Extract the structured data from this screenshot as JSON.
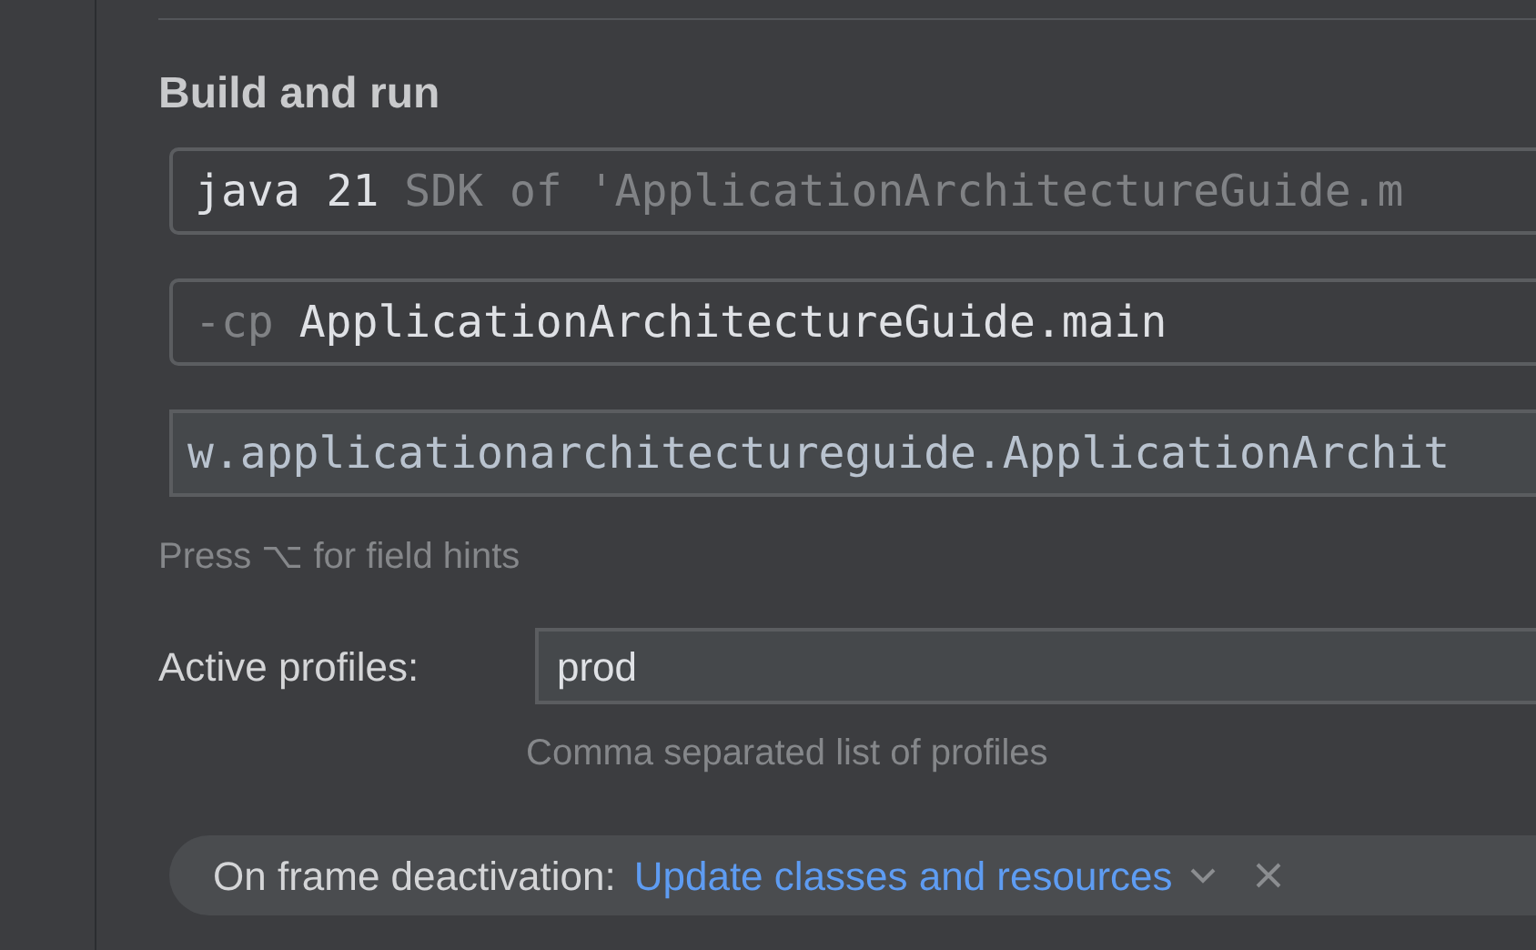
{
  "section": {
    "title": "Build and run"
  },
  "fields": [
    {
      "value": "java 21",
      "hint": "SDK of 'ApplicationArchitectureGuide.m",
      "focused": false
    },
    {
      "prefix": "-cp",
      "value": "ApplicationArchitectureGuide.main",
      "focused": false
    },
    {
      "value": "w.applicationarchitectureguide.ApplicationArchit",
      "focused": true
    }
  ],
  "field_hint": "Press ⌥ for field hints",
  "active_profiles": {
    "label": "Active profiles:",
    "value": "prod",
    "help": "Comma separated list of profiles"
  },
  "on_frame_deactivation": {
    "label": "On frame deactivation:",
    "value": "Update classes and resources"
  }
}
